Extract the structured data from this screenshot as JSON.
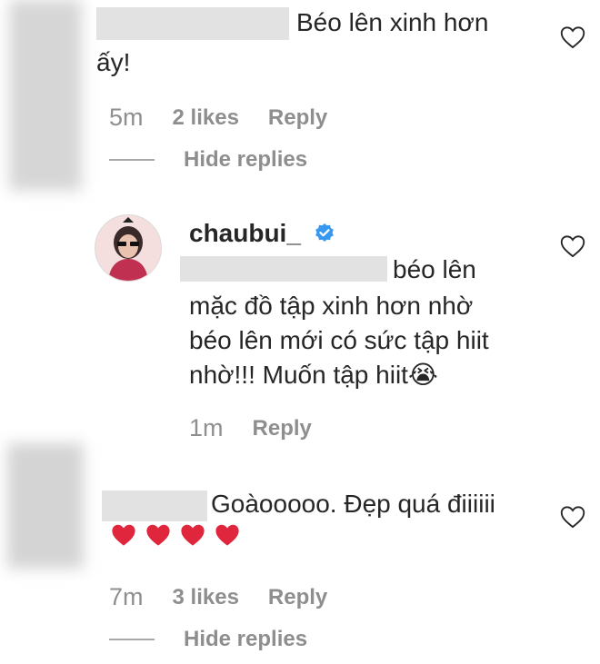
{
  "comment1": {
    "text_line1": "Béo lên xinh hơn",
    "text_line2": "ấy!",
    "time": "5m",
    "likes": "2 likes",
    "reply": "Reply",
    "hide_replies": "Hide replies"
  },
  "reply1": {
    "username": "chaubui_",
    "verified_icon": "verified-badge-icon",
    "line1": "béo lên",
    "line2": "mặc đồ tập xinh hơn nhờ",
    "line3": "béo lên mới có sức tập hiit",
    "line4": "nhờ!!! Muốn tập hiit😭",
    "time": "1m",
    "reply": "Reply"
  },
  "comment2": {
    "text_line1": "Goàooooo. Đẹp quá điiiiii",
    "hearts": [
      "❤️",
      "❤️",
      "❤️",
      "❤️"
    ],
    "time": "7m",
    "likes": "3 likes",
    "reply": "Reply",
    "hide_replies": "Hide replies"
  },
  "colors": {
    "text": "#262626",
    "meta": "#8e8e8e",
    "verified": "#3897f0",
    "emoji_heart": "#e0263d"
  },
  "icons": [
    "heart-outline-icon",
    "verified-badge-icon",
    "crying-face-emoji",
    "red-heart-emoji"
  ]
}
